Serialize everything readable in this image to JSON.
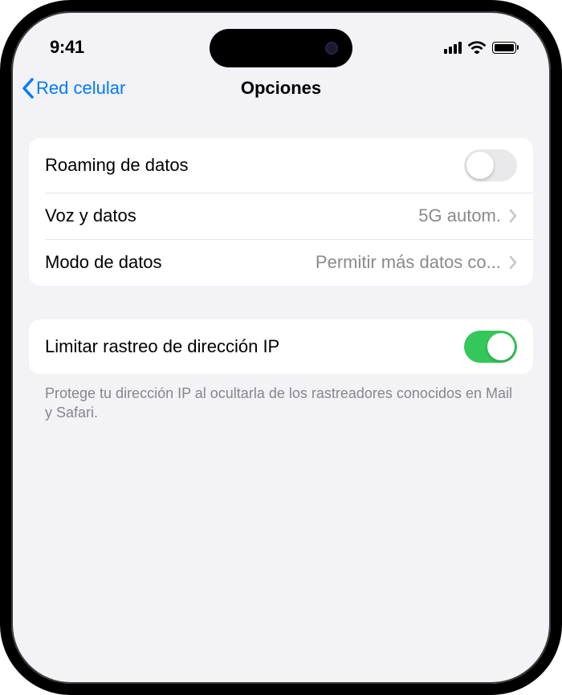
{
  "status": {
    "time": "9:41"
  },
  "nav": {
    "back_label": "Red celular",
    "title": "Opciones"
  },
  "group1": {
    "roaming": {
      "label": "Roaming de datos",
      "on": false
    },
    "voice": {
      "label": "Voz y datos",
      "value": "5G autom."
    },
    "data_mode": {
      "label": "Modo de datos",
      "value": "Permitir más datos co..."
    }
  },
  "group2": {
    "limit_ip": {
      "label": "Limitar rastreo de dirección IP",
      "on": true
    },
    "footer": "Protege tu dirección IP al ocultarla de los rastreadores conocidos en Mail y Safari."
  }
}
